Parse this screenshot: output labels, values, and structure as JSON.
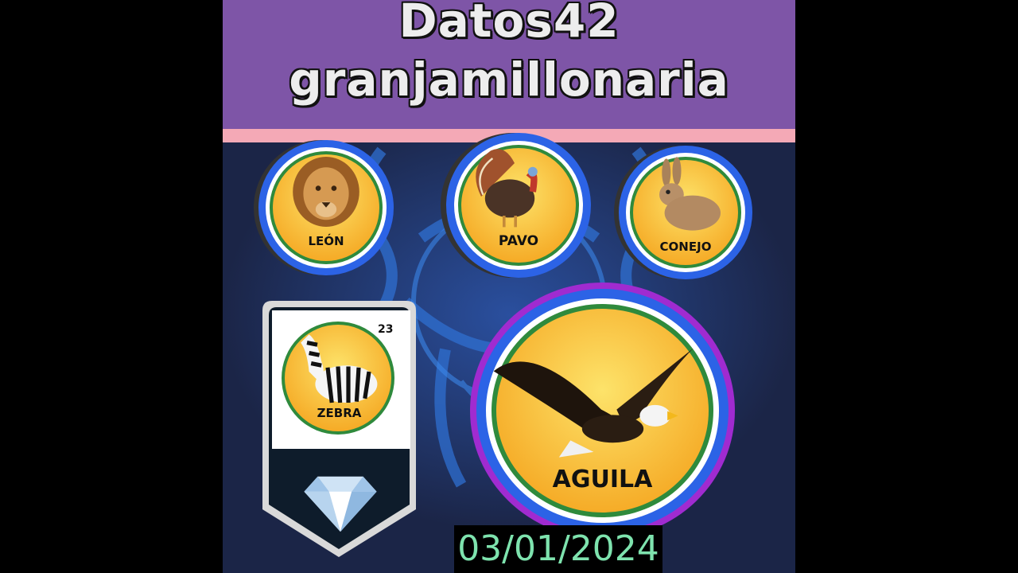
{
  "header": {
    "title_line1": "Datos42",
    "title_line2": "granjamillonaria"
  },
  "animals": {
    "leon": "LEÓN",
    "pavo": "PAVO",
    "conejo": "CONEJO",
    "zebra": "ZEBRA",
    "zebra_number": "23",
    "aguila": "AGUILA"
  },
  "date": "03/01/2024",
  "colors": {
    "banner": "#7e55a7",
    "banner_stripe": "#f4a9b6",
    "background": "#1b2547",
    "badge_ring": "#2c63e6",
    "badge_fill": "#f7a81b",
    "date_text": "#7ee3ae"
  },
  "icons": {
    "leon": "lion-icon",
    "pavo": "turkey-icon",
    "conejo": "rabbit-icon",
    "zebra": "zebra-icon",
    "aguila": "eagle-icon",
    "gem": "diamond-icon"
  }
}
